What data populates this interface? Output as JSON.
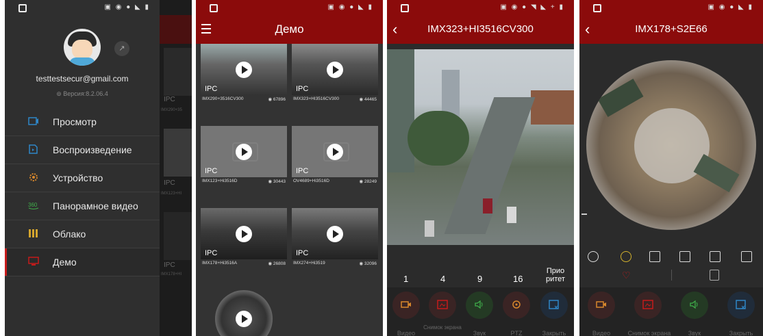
{
  "panel1": {
    "email": "testtestsecur@gmail.com",
    "version": "Версия:8.2.06.4",
    "menu": [
      {
        "label": "Просмотр",
        "icon": "live-view-icon",
        "color": "#2f87c8"
      },
      {
        "label": "Воспроизведение",
        "icon": "playback-icon",
        "color": "#2f87c8"
      },
      {
        "label": "Устройство",
        "icon": "device-gear-icon",
        "color": "#d7872c"
      },
      {
        "label": "Панорамное видео",
        "icon": "panorama-360-icon",
        "color": "#3fae4a"
      },
      {
        "label": "Облако",
        "icon": "cloud-icon",
        "color": "#d4a52d"
      },
      {
        "label": "Демо",
        "icon": "demo-icon",
        "color": "#c61b1b"
      }
    ],
    "side_labels": [
      "IPC",
      "IMX290+35",
      "IPC",
      "IMX123+HI",
      "IPC",
      "IMX178+HI"
    ]
  },
  "panel2": {
    "title": "Демо",
    "tiles": [
      {
        "type": "IPC",
        "caption": "IMX290+3516CV300",
        "views": "67896",
        "thumb": "night"
      },
      {
        "type": "IPC",
        "caption": "IMX323+HI3516CV300",
        "views": "44465",
        "thumb": "night"
      },
      {
        "type": "IPC",
        "caption": "IMX123+Hi3516D",
        "views": "30443",
        "thumb": "gray"
      },
      {
        "type": "IPC",
        "caption": "OV4689+Hi3516D",
        "views": "28249",
        "thumb": "gray"
      },
      {
        "type": "IPC",
        "caption": "IMX178+Hi3516A",
        "views": "26808",
        "thumb": "night"
      },
      {
        "type": "IPC",
        "caption": "IMX274+Hi3519",
        "views": "32096",
        "thumb": "night"
      },
      {
        "type": "",
        "caption": "",
        "views": "",
        "thumb": "fisheye"
      }
    ]
  },
  "panel3": {
    "title": "IMX323+HI3516CV300",
    "split_options": [
      "1",
      "4",
      "9",
      "16",
      "Прио\nритет"
    ],
    "actions": [
      {
        "label": "Видео",
        "icon": "video-record-icon",
        "color": "#d7872c"
      },
      {
        "label": "Снимок экрана",
        "icon": "screenshot-icon",
        "color": "#c61b1b"
      },
      {
        "label": "Звук",
        "icon": "sound-icon",
        "color": "#3fae4a"
      },
      {
        "label": "PTZ",
        "icon": "ptz-icon",
        "color": "#d7872c"
      },
      {
        "label": "Закрыть",
        "icon": "close-icon",
        "color": "#2f87c8"
      }
    ]
  },
  "panel4": {
    "title": "IMX178+S2E66",
    "actions": [
      {
        "label": "Видео",
        "icon": "video-record-icon",
        "color": "#d7872c"
      },
      {
        "label": "Снимок экрана",
        "icon": "screenshot-icon",
        "color": "#c61b1b"
      },
      {
        "label": "Звук",
        "icon": "sound-icon",
        "color": "#3fae4a"
      },
      {
        "label": "Закрыть",
        "icon": "close-icon",
        "color": "#2f87c8"
      }
    ]
  }
}
